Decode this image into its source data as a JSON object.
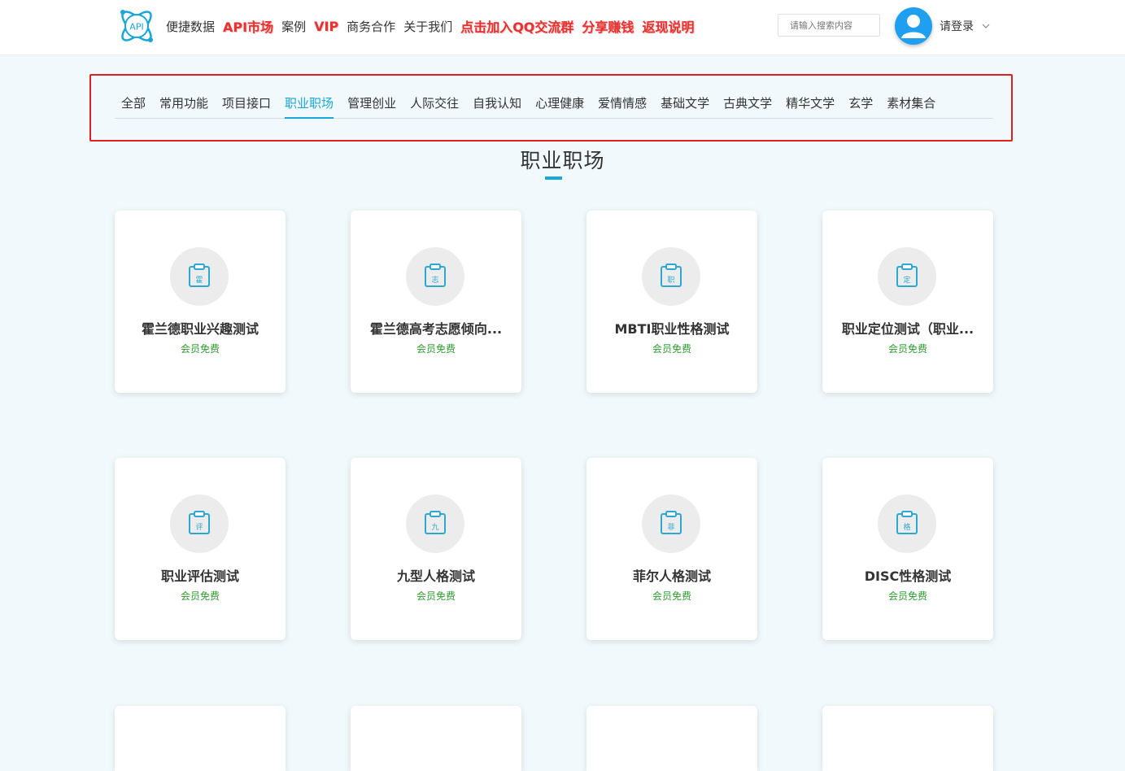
{
  "header": {
    "logo_text": "API",
    "nav": [
      {
        "label": "便捷数据",
        "hot": false
      },
      {
        "label": "API市场",
        "hot": true
      },
      {
        "label": "案例",
        "hot": false
      },
      {
        "label": "VIP",
        "hot": true
      },
      {
        "label": "商务合作",
        "hot": false
      },
      {
        "label": "关于我们",
        "hot": false
      },
      {
        "label": "点击加入QQ交流群",
        "hot": true
      },
      {
        "label": "分享赚钱",
        "hot": true
      },
      {
        "label": "返现说明",
        "hot": true
      }
    ],
    "search_placeholder": "请输入搜索内容",
    "login_label": "请登录"
  },
  "categories": [
    "全部",
    "常用功能",
    "项目接口",
    "职业职场",
    "管理创业",
    "人际交往",
    "自我认知",
    "心理健康",
    "爱情情感",
    "基础文学",
    "古典文学",
    "精华文学",
    "玄学",
    "素材集合"
  ],
  "active_category": "职业职场",
  "section_title": "职业职场",
  "cards": [
    {
      "icon_char": "霍",
      "name": "霍兰德职业兴趣测试",
      "price": "会员免费"
    },
    {
      "icon_char": "志",
      "name": "霍兰德高考志愿倾向...",
      "price": "会员免费"
    },
    {
      "icon_char": "职",
      "name": "MBTI职业性格测试",
      "price": "会员免费"
    },
    {
      "icon_char": "定",
      "name": "职业定位测试（职业...",
      "price": "会员免费"
    },
    {
      "icon_char": "评",
      "name": "职业评估测试",
      "price": "会员免费"
    },
    {
      "icon_char": "九",
      "name": "九型人格测试",
      "price": "会员免费"
    },
    {
      "icon_char": "菲",
      "name": "菲尔人格测试",
      "price": "会员免费"
    },
    {
      "icon_char": "格",
      "name": "DISC性格测试",
      "price": "会员免费"
    }
  ],
  "colors": {
    "accent": "#1aa6d6",
    "hot_link": "#e83232",
    "highlight_box": "#e02020",
    "price": "#2f9b2f",
    "page_bg": "#f1f9fc"
  }
}
